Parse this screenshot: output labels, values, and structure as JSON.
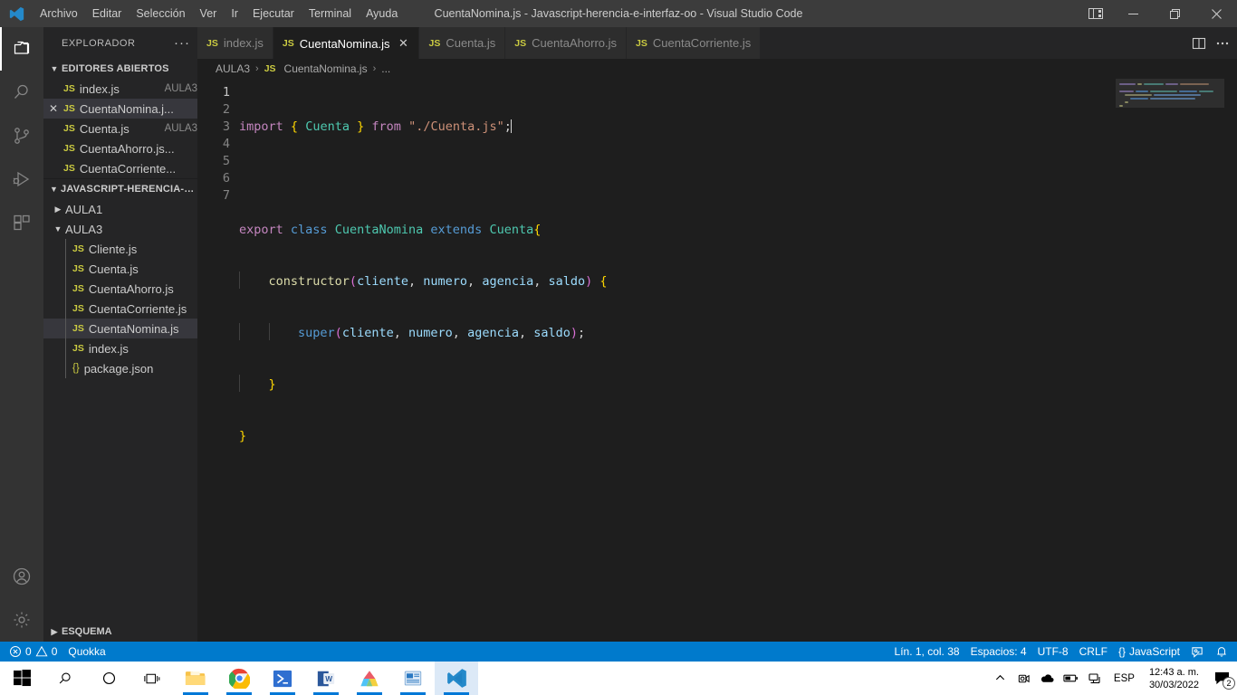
{
  "titlebar": {
    "logo_icon": "vscode-logo-icon",
    "window_title": "CuentaNomina.js - Javascript-herencia-e-interfaz-oo - Visual Studio Code",
    "menus": [
      {
        "label": "Archivo"
      },
      {
        "label": "Editar"
      },
      {
        "label": "Selección"
      },
      {
        "label": "Ver"
      },
      {
        "label": "Ir"
      },
      {
        "label": "Ejecutar"
      },
      {
        "label": "Terminal"
      },
      {
        "label": "Ayuda"
      }
    ],
    "layout_icon": "customize-layout-icon",
    "minimize_label": "—",
    "maximize_label": "❐",
    "close_label": "✕"
  },
  "activitybar": {
    "items": [
      {
        "icon": "files-explorer-icon",
        "name": "explorer",
        "active": true
      },
      {
        "icon": "search-icon",
        "name": "search",
        "active": false
      },
      {
        "icon": "source-control-icon",
        "name": "source-control",
        "active": false
      },
      {
        "icon": "run-and-debug-icon",
        "name": "run-debug",
        "active": false
      },
      {
        "icon": "extensions-icon",
        "name": "extensions",
        "active": false
      }
    ],
    "bottom_items": [
      {
        "icon": "account-icon",
        "name": "accounts"
      },
      {
        "icon": "gear-icon",
        "name": "manage-settings"
      }
    ]
  },
  "sidebar": {
    "header_title": "EXPLORADOR",
    "header_more_icon": "more-actions-icon",
    "open_editors": {
      "title": "EDITORES ABIERTOS",
      "expanded": true,
      "items": [
        {
          "name": "index.js",
          "desc": "AULA3",
          "icon": "js-file-icon",
          "selected": false,
          "closable": false
        },
        {
          "name": "CuentaNomina.j...",
          "desc": "",
          "icon": "js-file-icon",
          "selected": true,
          "closable": true
        },
        {
          "name": "Cuenta.js",
          "desc": "AULA3",
          "icon": "js-file-icon",
          "selected": false,
          "closable": false
        },
        {
          "name": "CuentaAhorro.js...",
          "desc": "",
          "icon": "js-file-icon",
          "selected": false,
          "closable": false
        },
        {
          "name": "CuentaCorriente...",
          "desc": "",
          "icon": "js-file-icon",
          "selected": false,
          "closable": false
        }
      ]
    },
    "workspace": {
      "title": "JAVASCRIPT-HERENCIA-E-I...",
      "expanded": true,
      "folders": [
        {
          "name": "AULA1",
          "expanded": false
        },
        {
          "name": "AULA3",
          "expanded": true
        }
      ],
      "files": [
        {
          "name": "Cliente.js",
          "icon": "js-file-icon",
          "selected": false
        },
        {
          "name": "Cuenta.js",
          "icon": "js-file-icon",
          "selected": false
        },
        {
          "name": "CuentaAhorro.js",
          "icon": "js-file-icon",
          "selected": false
        },
        {
          "name": "CuentaCorriente.js",
          "icon": "js-file-icon",
          "selected": false
        },
        {
          "name": "CuentaNomina.js",
          "icon": "js-file-icon",
          "selected": true
        },
        {
          "name": "index.js",
          "icon": "js-file-icon",
          "selected": false
        },
        {
          "name": "package.json",
          "icon": "json-file-icon",
          "selected": false
        }
      ]
    },
    "outline_title": "ESQUEMA"
  },
  "tabs": {
    "items": [
      {
        "label": "index.js",
        "icon": "js-file-icon",
        "active": false,
        "closable": false
      },
      {
        "label": "CuentaNomina.js",
        "icon": "js-file-icon",
        "active": true,
        "closable": true
      },
      {
        "label": "Cuenta.js",
        "icon": "js-file-icon",
        "active": false,
        "closable": false
      },
      {
        "label": "CuentaAhorro.js",
        "icon": "js-file-icon",
        "active": false,
        "closable": false
      },
      {
        "label": "CuentaCorriente.js",
        "icon": "js-file-icon",
        "active": false,
        "closable": false
      }
    ],
    "close_label": "✕",
    "split_icon": "split-editor-right-icon",
    "more_icon": "editor-actions-more-icon"
  },
  "breadcrumb": {
    "folder": "AULA3",
    "file": "CuentaNomina.js",
    "overflow": "...",
    "separator": "›"
  },
  "editor": {
    "line_numbers": [
      "1",
      "2",
      "3",
      "4",
      "5",
      "6",
      "7"
    ],
    "active_line": 1,
    "code_lines": [
      "import { Cuenta } from \"./Cuenta.js\";",
      "",
      "export class CuentaNomina extends Cuenta{",
      "    constructor(cliente, numero, agencia, saldo) {",
      "        super(cliente, numero, agencia, saldo);",
      "    }",
      "}"
    ],
    "tokens": {
      "import": "import",
      "brace_open": "{",
      "brace_close": "}",
      "cuenta": "Cuenta",
      "from": "from",
      "path_string": "\"./Cuenta.js\"",
      "semicolon": ";",
      "export": "export",
      "class": "class",
      "class_name": "CuentaNomina",
      "extends": "extends",
      "parent_class": "Cuenta",
      "constructor": "constructor",
      "super": "super",
      "paren_open": "(",
      "paren_close": ")",
      "param_cliente": "cliente",
      "param_numero": "numero",
      "param_agencia": "agencia",
      "param_saldo": "saldo",
      "comma": ",",
      "curly_open": "{"
    }
  },
  "statusbar": {
    "errors_icon": "error-icon",
    "errors_count": "0",
    "warnings_icon": "warning-icon",
    "warnings_count": "0",
    "quokka_label": "Quokka",
    "cursor_position": "Lín. 1, col. 38",
    "indentation": "Espacios: 4",
    "encoding": "UTF-8",
    "eol": "CRLF",
    "language_icon": "{}",
    "language": "JavaScript",
    "feedback_icon": "tweet-feedback-icon",
    "bell_icon": "notifications-bell-icon",
    "background_color": "#007acc"
  },
  "taskbar": {
    "start_icon": "windows-start-icon",
    "search_icon": "taskbar-search-icon",
    "cortana_icon": "cortana-icon",
    "taskview_icon": "task-view-icon",
    "apps": [
      {
        "name": "file-explorer",
        "icon": "file-explorer-icon",
        "running": true,
        "active": false
      },
      {
        "name": "google-chrome",
        "icon": "chrome-icon",
        "running": true,
        "active": false
      },
      {
        "name": "powershell",
        "icon": "powershell-icon",
        "running": true,
        "active": false
      },
      {
        "name": "microsoft-word",
        "icon": "word-icon",
        "running": true,
        "active": false
      },
      {
        "name": "google-drive",
        "icon": "drive-icon",
        "running": true,
        "active": false
      },
      {
        "name": "powerpoint",
        "icon": "powerpoint-icon",
        "running": true,
        "active": false
      },
      {
        "name": "visual-studio-code",
        "icon": "vscode-icon",
        "running": true,
        "active": true
      }
    ],
    "tray": {
      "overflow_icon": "show-hidden-icons-icon",
      "icons": [
        {
          "name": "camera-icon"
        },
        {
          "name": "onedrive-cloud-icon"
        },
        {
          "name": "battery-icon"
        },
        {
          "name": "network-icon"
        }
      ],
      "language": "ESP",
      "time": "12:43 a. m.",
      "date": "30/03/2022",
      "notifications_icon": "action-center-icon",
      "notifications_count": "2"
    }
  }
}
